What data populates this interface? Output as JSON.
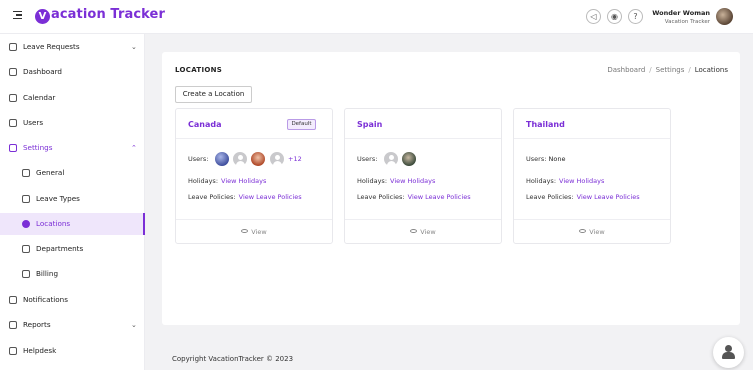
{
  "app": {
    "logo_letter": "V",
    "name": "acation Tracker",
    "brand_color": "#7b2fd6"
  },
  "header": {
    "icons": [
      "megaphone-icon",
      "lightbulb-icon",
      "help-icon"
    ],
    "help_glyph": "?",
    "user_name": "Wonder Woman",
    "company": "Vacation Tracker"
  },
  "sidebar": {
    "items": [
      {
        "label": "Leave Requests",
        "icon": "bolt-icon",
        "chevron": "⌄"
      },
      {
        "label": "Dashboard",
        "icon": "dashboard-icon"
      },
      {
        "label": "Calendar",
        "icon": "calendar-icon"
      },
      {
        "label": "Users",
        "icon": "user-icon"
      },
      {
        "label": "Settings",
        "icon": "gear-icon",
        "chevron": "⌃"
      },
      {
        "label": "General",
        "icon": "document-icon"
      },
      {
        "label": "Leave Types",
        "icon": "share-icon"
      },
      {
        "label": "Locations",
        "icon": "location-pin-icon"
      },
      {
        "label": "Departments",
        "icon": "building-icon"
      },
      {
        "label": "Billing",
        "icon": "dollar-icon"
      },
      {
        "label": "Notifications",
        "icon": "bell-icon"
      },
      {
        "label": "Reports",
        "icon": "report-icon",
        "chevron": "⌄"
      },
      {
        "label": "Helpdesk",
        "icon": "question-icon"
      }
    ]
  },
  "page": {
    "title": "LOCATIONS",
    "breadcrumb": [
      "Dashboard",
      "Settings",
      "Locations"
    ],
    "breadcrumb_sep": "/",
    "create_button": "Create a Location"
  },
  "labels": {
    "users": "Users:",
    "holidays": "Holidays:",
    "leave_policies": "Leave Policies:",
    "view_holidays": "View Holidays",
    "view_leave_policies": "View Leave Policies",
    "view": "View",
    "default": "Default"
  },
  "cards": [
    {
      "name": "Canada",
      "is_default": true,
      "users_more": "+12"
    },
    {
      "name": "Spain",
      "is_default": false
    },
    {
      "name": "Thailand",
      "is_default": false,
      "users_text": "None"
    }
  ],
  "footer": {
    "copyright": "Copyright VacationTracker © 2023"
  }
}
